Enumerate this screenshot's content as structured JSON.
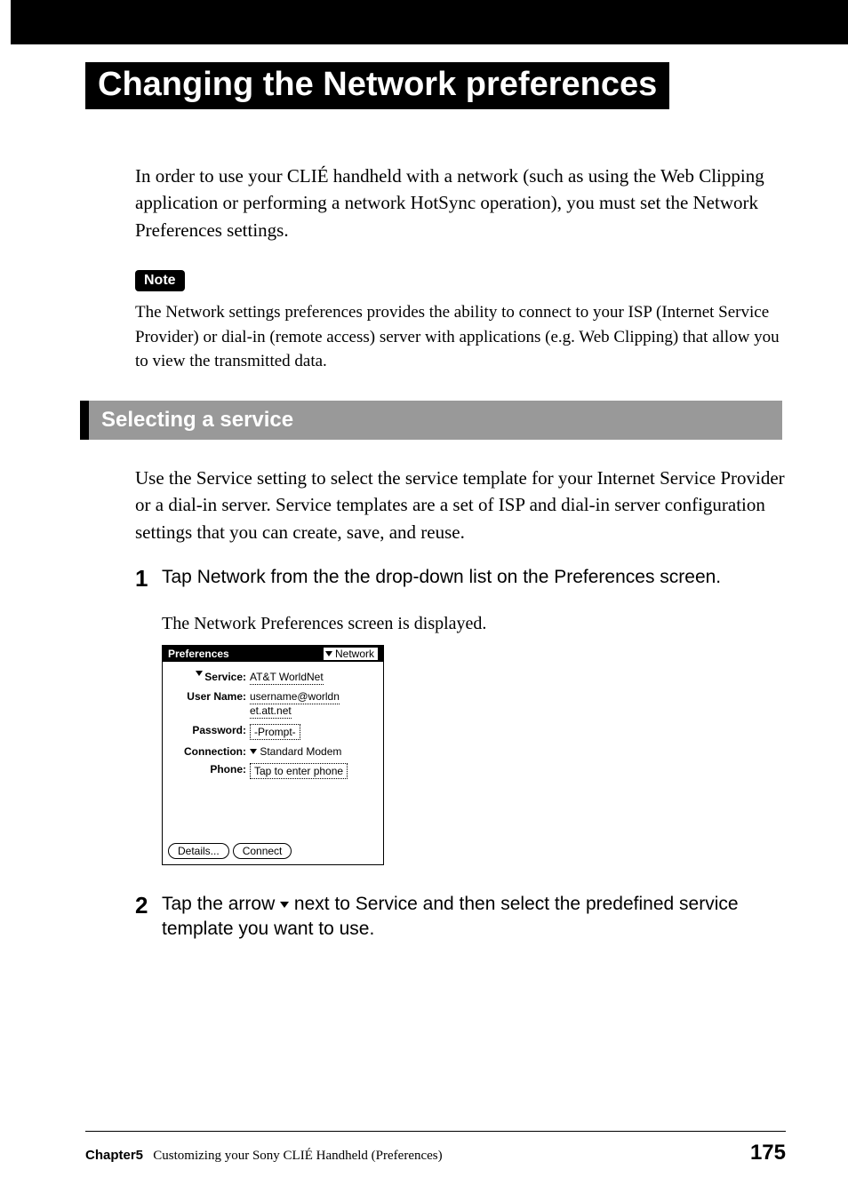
{
  "header": {
    "page_title": "Changing the Network preferences"
  },
  "intro_text": "In order to use your CLIÉ handheld with a network (such as using the Web Clipping application or performing a network HotSync operation), you must set the Network Preferences settings.",
  "note": {
    "label": "Note",
    "text": "The Network settings preferences provides the ability to connect to your ISP (Internet Service Provider) or dial-in (remote access) server with applications (e.g. Web Clipping) that allow you to view the transmitted data."
  },
  "section": {
    "title": "Selecting a service",
    "intro": "Use the Service setting to select the service template for your Internet Service Provider or a dial-in server. Service templates are a set of ISP and dial-in server configuration settings that you can create, save, and reuse."
  },
  "steps": [
    {
      "num": "1",
      "title": "Tap Network from the the drop-down list on the Preferences screen.",
      "sub": "The Network Preferences screen is displayed."
    },
    {
      "num": "2",
      "title": "Tap the arrow V next to Service and then select the predefined service template you want to use."
    }
  ],
  "palm": {
    "header_left": "Preferences",
    "header_right": "Network",
    "rows": {
      "service_label": "Service:",
      "service_value": "AT&T WorldNet",
      "username_label": "User Name:",
      "username_value_1": "username@worldn",
      "username_value_2": "et.att.net",
      "password_label": "Password:",
      "password_value": "-Prompt-",
      "connection_label": "Connection:",
      "connection_value": "Standard Modem",
      "phone_label": "Phone:",
      "phone_value": "Tap to enter phone"
    },
    "buttons": {
      "details": "Details...",
      "connect": "Connect"
    }
  },
  "footer": {
    "chapter_label": "Chapter5",
    "chapter_title": "Customizing your Sony CLIÉ Handheld (Preferences)",
    "page_number": "175"
  }
}
